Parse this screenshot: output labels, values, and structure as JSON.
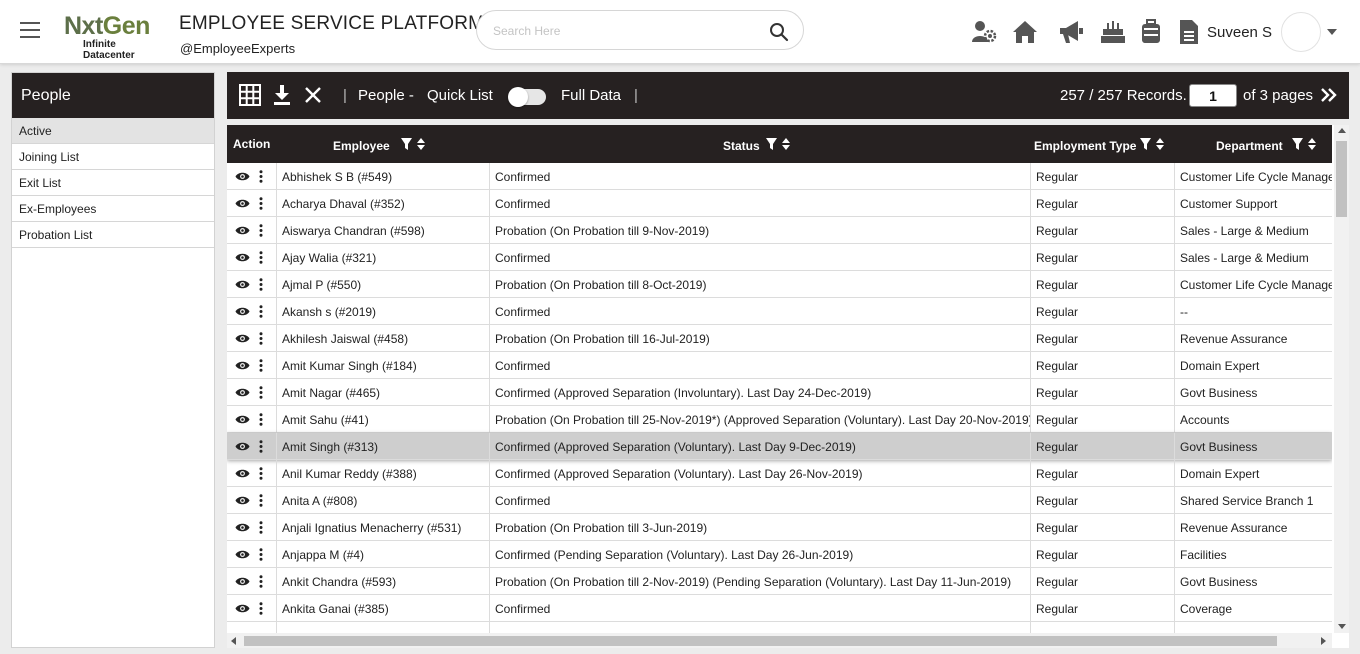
{
  "header": {
    "logo_brand_a": "Nxt",
    "logo_brand_b": "Gen",
    "logo_sub": "Infinite Datacenter",
    "app_title": "EMPLOYEE SERVICE PLATFORM",
    "app_subtitle": "@EmployeeExperts",
    "search_placeholder": "Search Here",
    "user_name": "Suveen S",
    "icons": [
      "menu-icon",
      "team-settings-icon",
      "home-icon",
      "announcement-icon",
      "birthday-cake-icon",
      "luggage-icon",
      "document-icon",
      "user-avatar",
      "chevron-down-icon"
    ]
  },
  "sidebar": {
    "title": "People",
    "items": [
      {
        "label": "Active",
        "active": true
      },
      {
        "label": "Joining List",
        "active": false
      },
      {
        "label": "Exit List",
        "active": false
      },
      {
        "label": "Ex-Employees",
        "active": false
      },
      {
        "label": "Probation List",
        "active": false
      }
    ]
  },
  "toolbar": {
    "people_label": "People -",
    "quick_list_label": "Quick List",
    "full_data_label": "Full Data",
    "separator": "|",
    "records_text": "257 / 257 Records.",
    "page_value": "1",
    "pages_text": "of 3 pages",
    "icons": [
      "grid-icon",
      "download-icon",
      "close-icon",
      "double-chevron-right-icon"
    ]
  },
  "table": {
    "headers": {
      "action": "Action",
      "employee": "Employee",
      "status": "Status",
      "employment_type": "Employment Type",
      "department": "Department"
    },
    "rows": [
      {
        "employee": "Abhishek S B (#549)",
        "status": "Confirmed",
        "type": "Regular",
        "department": "Customer Life Cycle Manage"
      },
      {
        "employee": "Acharya Dhaval (#352)",
        "status": "Confirmed",
        "type": "Regular",
        "department": "Customer Support"
      },
      {
        "employee": "Aiswarya Chandran (#598)",
        "status": "Probation (On Probation till 9-Nov-2019)",
        "type": "Regular",
        "department": "Sales - Large & Medium"
      },
      {
        "employee": "Ajay Walia (#321)",
        "status": "Confirmed",
        "type": "Regular",
        "department": "Sales - Large & Medium"
      },
      {
        "employee": "Ajmal P (#550)",
        "status": "Probation (On Probation till 8-Oct-2019)",
        "type": "Regular",
        "department": "Customer Life Cycle Manage"
      },
      {
        "employee": "Akansh s (#2019)",
        "status": "Confirmed",
        "type": "Regular",
        "department": "--"
      },
      {
        "employee": "Akhilesh Jaiswal (#458)",
        "status": "Probation (On Probation till 16-Jul-2019)",
        "type": "Regular",
        "department": "Revenue Assurance"
      },
      {
        "employee": "Amit Kumar Singh (#184)",
        "status": "Confirmed",
        "type": "Regular",
        "department": "Domain Expert"
      },
      {
        "employee": "Amit Nagar (#465)",
        "status": "Confirmed (Approved Separation (Involuntary). Last Day 24-Dec-2019)",
        "type": "Regular",
        "department": "Govt Business"
      },
      {
        "employee": "Amit Sahu (#41)",
        "status": "Probation (On Probation till 25-Nov-2019*) (Approved Separation (Voluntary). Last Day 20-Nov-2019)",
        "type": "Regular",
        "department": "Accounts"
      },
      {
        "employee": "Amit Singh (#313)",
        "status": "Confirmed (Approved Separation (Voluntary). Last Day 9-Dec-2019)",
        "type": "Regular",
        "department": "Govt Business",
        "selected": true
      },
      {
        "employee": "Anil Kumar Reddy (#388)",
        "status": "Confirmed (Approved Separation (Voluntary). Last Day 26-Nov-2019)",
        "type": "Regular",
        "department": "Domain Expert"
      },
      {
        "employee": "Anita A (#808)",
        "status": "Confirmed",
        "type": "Regular",
        "department": "Shared Service Branch 1"
      },
      {
        "employee": "Anjali Ignatius Menacherry (#531)",
        "status": "Probation (On Probation till 3-Jun-2019)",
        "type": "Regular",
        "department": "Revenue Assurance"
      },
      {
        "employee": "Anjappa M (#4)",
        "status": "Confirmed (Pending Separation (Voluntary). Last Day 26-Jun-2019)",
        "type": "Regular",
        "department": "Facilities"
      },
      {
        "employee": "Ankit Chandra (#593)",
        "status": "Probation (On Probation till 2-Nov-2019) (Pending Separation (Voluntary). Last Day 11-Jun-2019)",
        "type": "Regular",
        "department": "Govt Business"
      },
      {
        "employee": "Ankita Ganai (#385)",
        "status": "Confirmed",
        "type": "Regular",
        "department": "Coverage"
      },
      {
        "employee": "",
        "status": "",
        "type": "",
        "department": ""
      }
    ]
  },
  "colors": {
    "dark_bar": "#262121",
    "selected_row": "#cecece",
    "logo_green": "#6a7f3d"
  }
}
